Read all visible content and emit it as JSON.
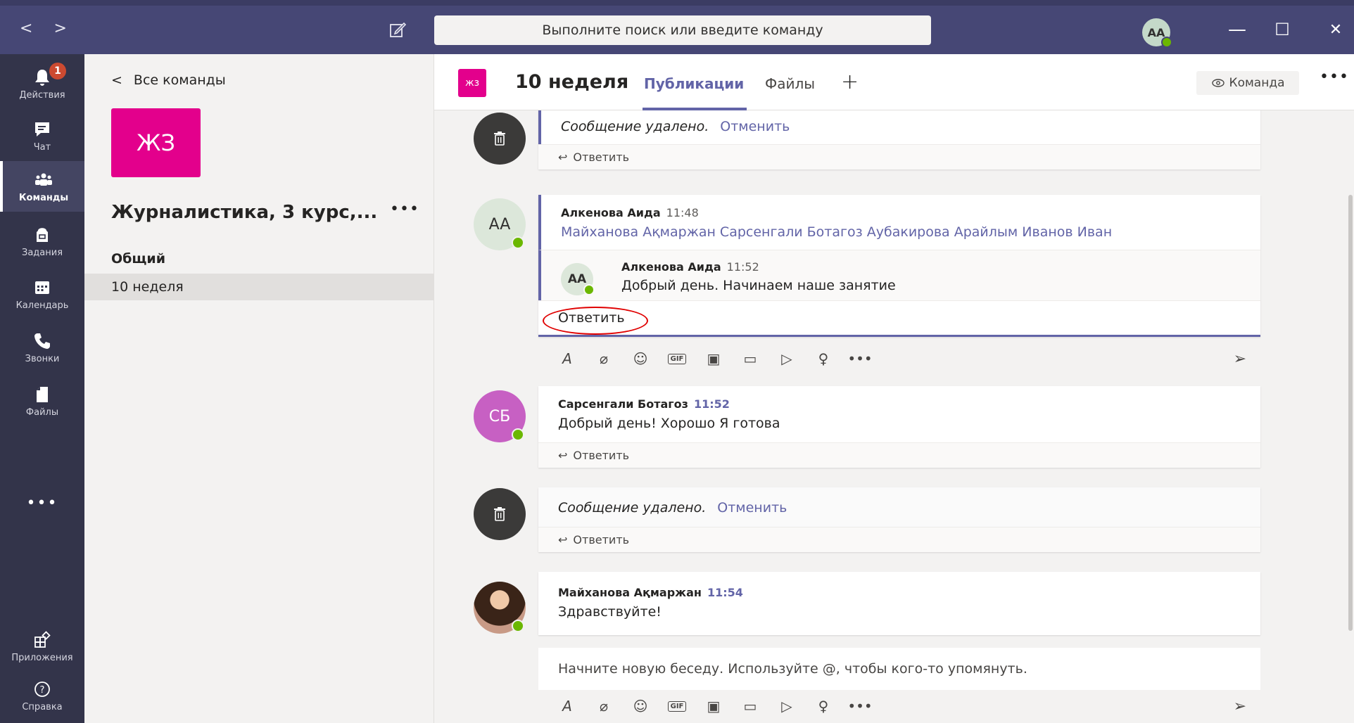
{
  "titlebar": {
    "back": "<",
    "forward": ">",
    "search_placeholder": "Выполните поиск или введите команду",
    "avatar_initials": "AA",
    "minimize": "—",
    "maximize": "☐",
    "close": "✕"
  },
  "rail": {
    "items": [
      {
        "label": "Действия",
        "badge": "1"
      },
      {
        "label": "Чат"
      },
      {
        "label": "Команды"
      },
      {
        "label": "Задания"
      },
      {
        "label": "Календарь"
      },
      {
        "label": "Звонки"
      },
      {
        "label": "Файлы"
      }
    ],
    "more": "•••",
    "apps": "Приложения",
    "help": "Справка"
  },
  "team_panel": {
    "back_label": "Все команды",
    "tile_initials": "ЖЗ",
    "team_name": "Журналистика, 3 курс,...",
    "more": "•••",
    "channels": [
      "Общий",
      "10 неделя"
    ]
  },
  "channel_header": {
    "tile_initials": "жз",
    "title": "10 неделя",
    "tabs": [
      "Публикации",
      "Файлы"
    ],
    "add_tab": "+",
    "team_button": "Команда",
    "more": "•••"
  },
  "messages": {
    "deleted_text": "Сообщение удалено.",
    "undo_label": "Отменить",
    "reply_label": "Ответить",
    "thread": {
      "author": "Алкенова Аида",
      "time": "11:48",
      "avatar": "AA",
      "mentions": "Майханова Ақмаржан Сарсенгали Ботагоз Аубакирова Арайлым Иванов Иван",
      "reply": {
        "author": "Алкенова Аида",
        "time": "11:52",
        "avatar": "AA",
        "text": "Добрый день. Начинаем наше занятие"
      },
      "reply_box": "Ответить"
    },
    "msg_sb": {
      "author": "Сарсенгали Ботагоз",
      "time": "11:52",
      "avatar": "СБ",
      "text": "Добрый день! Хорошо Я готова"
    },
    "msg_ma": {
      "author": "Майханова Ақмаржан",
      "time": "11:54",
      "text": "Здравствуйте!"
    },
    "new_conversation_placeholder": "Начните новую беседу. Используйте @, чтобы кого-то упомянуть."
  },
  "colors": {
    "titlebar": "#464775",
    "rail": "#33344a",
    "accent": "#6264a7",
    "team_tile": "#e3008c",
    "badge": "#cc4a31",
    "presence": "#6bb700",
    "annotation": "#e00000"
  }
}
